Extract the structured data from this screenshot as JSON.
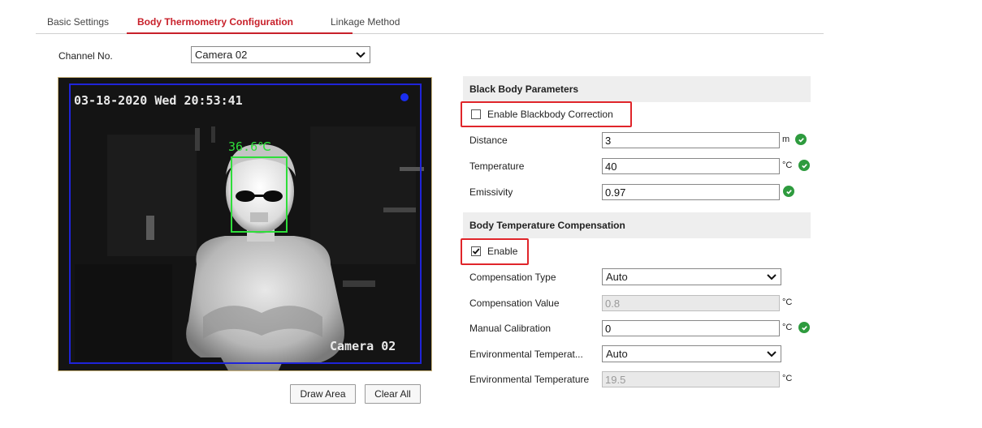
{
  "tabs": [
    {
      "label": "Basic Settings",
      "active": false
    },
    {
      "label": "Body Thermometry Configuration",
      "active": true
    },
    {
      "label": "Linkage Method",
      "active": false
    }
  ],
  "channel": {
    "label": "Channel No.",
    "value": "Camera 02"
  },
  "video": {
    "timestamp": "03-18-2020 Wed 20:53:41",
    "camera_name": "Camera 02",
    "temperature_tag": "36.6℃"
  },
  "buttons": {
    "draw_area": "Draw Area",
    "clear_all": "Clear All"
  },
  "black_body": {
    "title": "Black Body Parameters",
    "enable_label": "Enable Blackbody Correction",
    "enable_checked": false,
    "distance": {
      "label": "Distance",
      "value": "3",
      "unit": "m"
    },
    "temperature": {
      "label": "Temperature",
      "value": "40",
      "unit": "°C"
    },
    "emissivity": {
      "label": "Emissivity",
      "value": "0.97"
    }
  },
  "compensation": {
    "title": "Body Temperature Compensation",
    "enable_label": "Enable",
    "enable_checked": true,
    "type": {
      "label": "Compensation Type",
      "value": "Auto"
    },
    "value": {
      "label": "Compensation Value",
      "value": "0.8",
      "unit": "°C"
    },
    "manual": {
      "label": "Manual Calibration",
      "value": "0",
      "unit": "°C"
    },
    "env_mode": {
      "label": "Environmental Temperat...",
      "value": "Auto"
    },
    "env_temp": {
      "label": "Environmental Temperature",
      "value": "19.5",
      "unit": "°C"
    }
  },
  "colors": {
    "accent": "#c8202a",
    "highlight": "#e0252a",
    "ok": "#2e9b3e",
    "face_box": "#2ede3a",
    "area_box": "#1f24d9"
  }
}
